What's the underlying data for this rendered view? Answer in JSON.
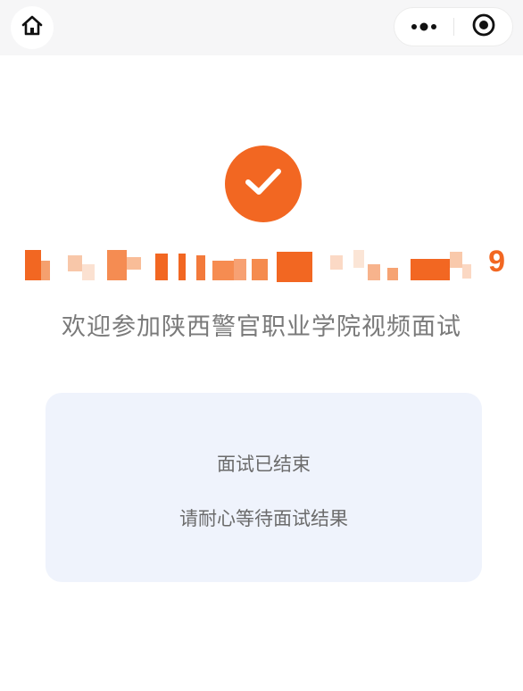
{
  "top_bar": {
    "home_icon": "home-icon",
    "more_icon": "more-dots-icon",
    "close_icon": "record-close-icon"
  },
  "status": {
    "icon": "check-circle-icon",
    "accent_color": "#f26722"
  },
  "candidate": {
    "visible_suffix": "9"
  },
  "welcome_text": "欢迎参加陕西警官职业学院视频面试",
  "card": {
    "line1": "面试已结束",
    "line2": "请耐心等待面试结果"
  }
}
